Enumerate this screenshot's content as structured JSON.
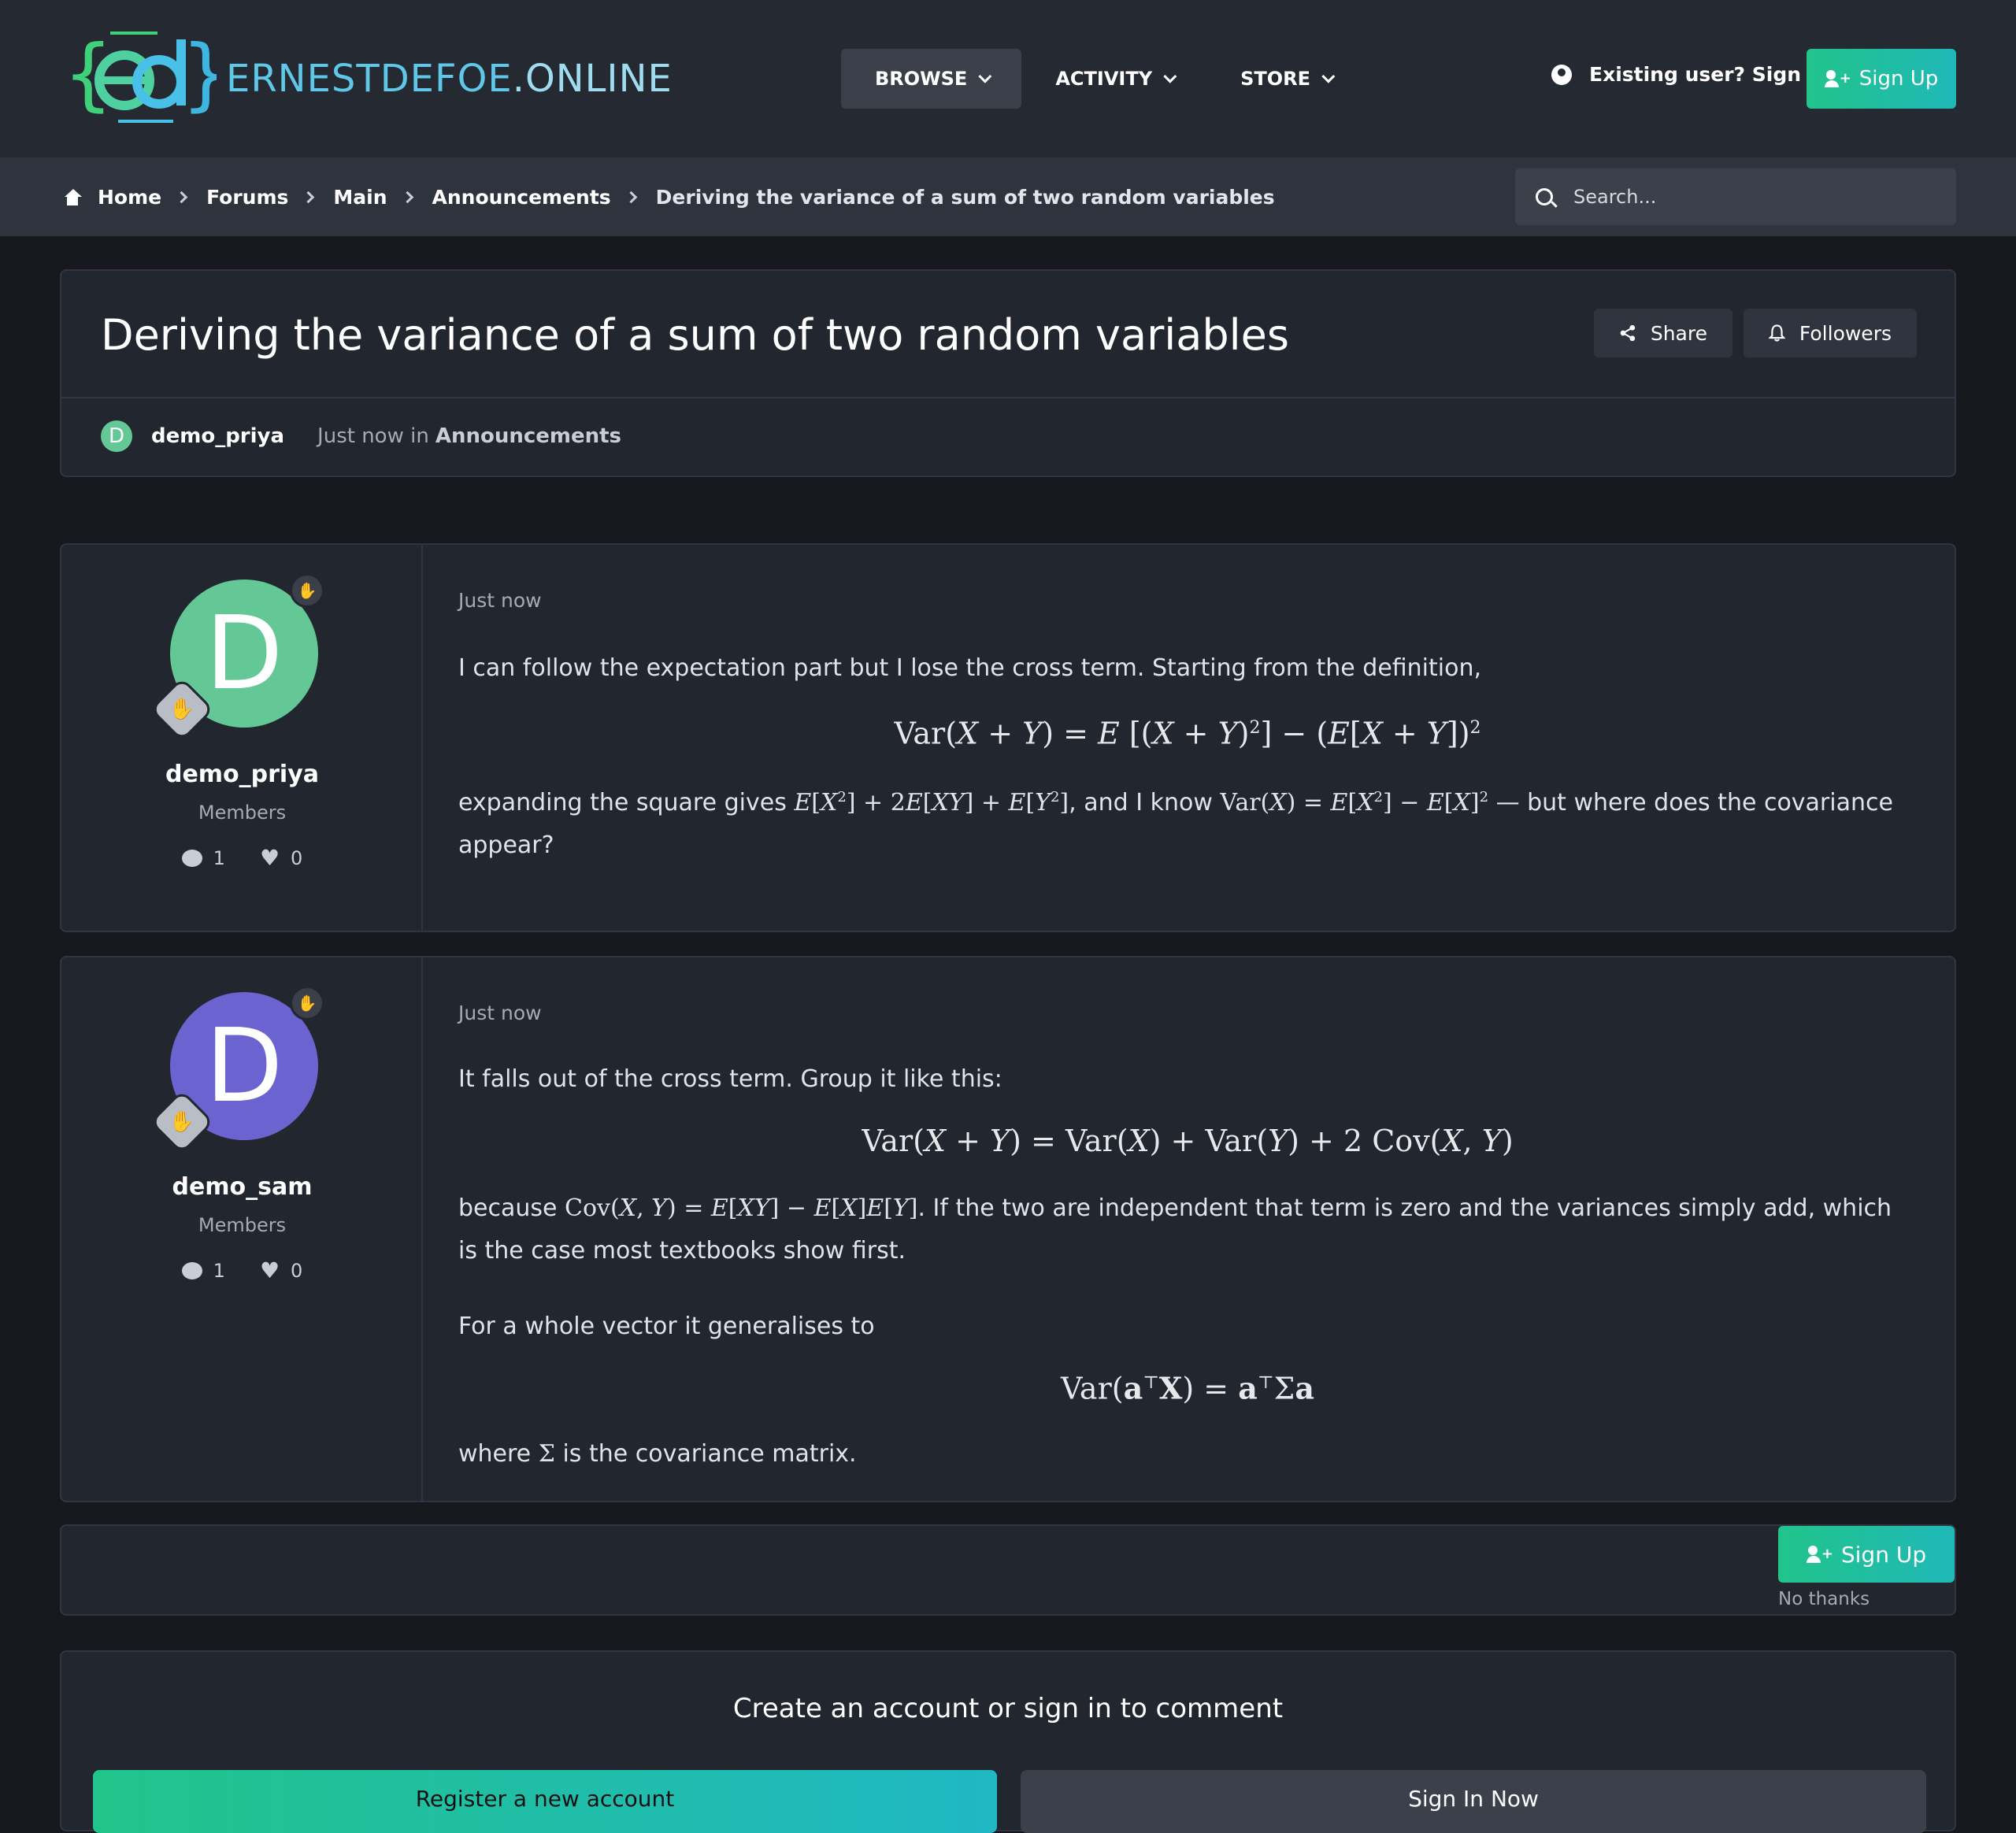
{
  "header": {
    "logo_text_main": "ERNESTDEFOE",
    "logo_text_tld": ".ONLINE",
    "nav": [
      {
        "label": "BROWSE"
      },
      {
        "label": "ACTIVITY"
      },
      {
        "label": "STORE"
      }
    ],
    "signin_label": "Existing user? Sign In",
    "signup_label": "Sign Up"
  },
  "breadcrumb": {
    "items": [
      "Home",
      "Forums",
      "Main",
      "Announcements",
      "Deriving the variance of a sum of two random variables"
    ],
    "search_placeholder": "Search..."
  },
  "topic": {
    "title": "Deriving the variance of a sum of two random variables",
    "share_label": "Share",
    "followers_label": "Followers",
    "author_initial": "D",
    "author": "demo_priya",
    "when_prefix": "Just now in",
    "forum": "Announcements"
  },
  "posts": [
    {
      "initial": "D",
      "avatar_color": "#63c796",
      "username": "demo_priya",
      "group": "Members",
      "comments": "1",
      "likes": "0",
      "timestamp": "Just now"
    },
    {
      "initial": "D",
      "avatar_color": "#6b63cf",
      "username": "demo_sam",
      "group": "Members",
      "comments": "1",
      "likes": "0",
      "timestamp": "Just now"
    }
  ],
  "post_text": {
    "p1_intro": "I can follow the expectation part but I lose the cross term. Starting from the definition,",
    "p1_expand_a": "expanding the square gives",
    "p1_expand_b": ", and I know",
    "p1_expand_c": "— but where does the covariance appear?",
    "p2_intro": "It falls out of the cross term. Group it like this:",
    "p2_because_a": "because",
    "p2_because_b": ". If the two are independent that term is zero and the variances simply add, which is the case most textbooks show first.",
    "p2_vector": "For a whole vector it generalises to",
    "p2_where_a": "where",
    "p2_where_b": "is the covariance matrix."
  },
  "signup_prompt": {
    "button": "Sign Up",
    "dismiss": "No thanks"
  },
  "comment": {
    "title": "Create an account or sign in to comment",
    "register": "Register a new account",
    "signin": "Sign In Now"
  },
  "colors": {
    "accent": "#21c48a",
    "background": "#16181d",
    "panel": "#22262e"
  }
}
